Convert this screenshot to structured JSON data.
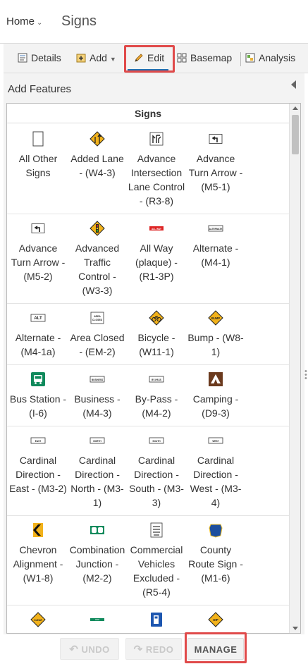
{
  "header": {
    "home_label": "Home",
    "map_title": "Signs"
  },
  "toolbar": {
    "details": "Details",
    "add": "Add",
    "edit": "Edit",
    "basemap": "Basemap",
    "analysis": "Analysis"
  },
  "panel": {
    "title": "Add Features",
    "layer_name": "Signs"
  },
  "templates": [
    [
      {
        "label": "All Other Signs",
        "icon": "blank-sign-icon"
      },
      {
        "label": "Added Lane - (W4-3)",
        "icon": "added-lane-sign-icon"
      },
      {
        "label": "Advance Intersection Lane Control - (R3-8)",
        "icon": "lane-control-sign-icon"
      },
      {
        "label": "Advance Turn Arrow - (M5-1)",
        "icon": "turn-arrow-sign-icon"
      }
    ],
    [
      {
        "label": "Advance Turn Arrow - (M5-2)",
        "icon": "turn-arrow-sign-icon"
      },
      {
        "label": "Advanced Traffic Control - (W3-3)",
        "icon": "traffic-signal-sign-icon"
      },
      {
        "label": "All Way (plaque) - (R1-3P)",
        "icon": "all-way-plaque-icon",
        "text": "ALL WAY"
      },
      {
        "label": "Alternate - (M4-1)",
        "icon": "alternate-sign-icon",
        "text": "ALTERNATE"
      }
    ],
    [
      {
        "label": "Alternate - (M4-1a)",
        "icon": "alt-sign-icon",
        "text": "ALT"
      },
      {
        "label": "Area Closed - (EM-2)",
        "icon": "area-closed-sign-icon",
        "text": "AREA CLOSED"
      },
      {
        "label": "Bicycle - (W11-1)",
        "icon": "bicycle-sign-icon"
      },
      {
        "label": "Bump - (W8-1)",
        "icon": "bump-sign-icon",
        "text": "BUMP"
      }
    ],
    [
      {
        "label": "Bus Station - (I-6)",
        "icon": "bus-sign-icon"
      },
      {
        "label": "Business - (M4-3)",
        "icon": "business-sign-icon",
        "text": "BUSINESS"
      },
      {
        "label": "By-Pass - (M4-2)",
        "icon": "bypass-sign-icon",
        "text": "BY-PASS"
      },
      {
        "label": "Camping - (D9-3)",
        "icon": "camping-sign-icon"
      }
    ],
    [
      {
        "label": "Cardinal Direction - East - (M3-2)",
        "icon": "east-sign-icon",
        "text": "EAST"
      },
      {
        "label": "Cardinal Direction - North - (M3-1)",
        "icon": "north-sign-icon",
        "text": "NORTH"
      },
      {
        "label": "Cardinal Direction - South - (M3-3)",
        "icon": "south-sign-icon",
        "text": "SOUTH"
      },
      {
        "label": "Cardinal Direction - West - (M3-4)",
        "icon": "west-sign-icon",
        "text": "WEST"
      }
    ],
    [
      {
        "label": "Chevron Alignment - (W1-8)",
        "icon": "chevron-sign-icon"
      },
      {
        "label": "Combination Junction - (M2-2)",
        "icon": "combination-junction-sign-icon"
      },
      {
        "label": "Commercial Vehicles Excluded - (R5-4)",
        "icon": "commercial-vehicles-sign-icon"
      },
      {
        "label": "County Route Sign - (M1-6)",
        "icon": "county-route-sign-icon"
      }
    ],
    [
      {
        "label": "",
        "icon": "clear-sign-icon",
        "text": "CLEAR"
      },
      {
        "label": "",
        "icon": "green-strip-sign-icon"
      },
      {
        "label": "",
        "icon": "gas-station-sign-icon"
      },
      {
        "label": "",
        "icon": "dip-sign-icon",
        "text": "DIP"
      }
    ]
  ],
  "bottom": {
    "undo": "UNDO",
    "redo": "REDO",
    "manage": "MANAGE"
  },
  "colors": {
    "highlight": "#e04a4a",
    "edit_underline": "#1f6fb2",
    "warning_yellow": "#f2b21b",
    "guide_green": "#108a5c"
  }
}
